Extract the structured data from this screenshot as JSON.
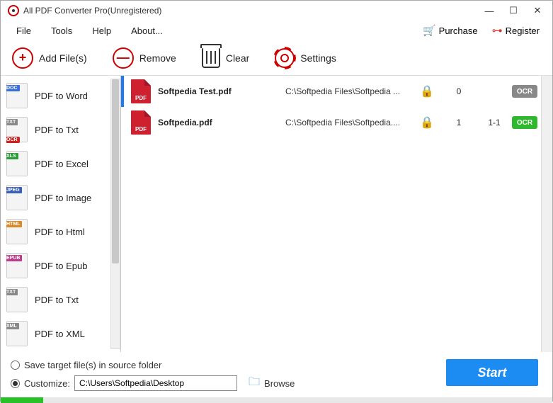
{
  "title": "All PDF Converter Pro(Unregistered)",
  "menu": {
    "file": "File",
    "tools": "Tools",
    "help": "Help",
    "about": "About...",
    "purchase": "Purchase",
    "register": "Register"
  },
  "toolbar": {
    "add": "Add File(s)",
    "remove": "Remove",
    "clear": "Clear",
    "settings": "Settings"
  },
  "sidebar": [
    {
      "label": "PDF to Word",
      "tag": "DOC",
      "tagClass": "tag-doc"
    },
    {
      "label": "PDF to Txt",
      "tag": "TXT",
      "tagClass": "tag-txt",
      "ocr": true
    },
    {
      "label": "PDF to Excel",
      "tag": "XLS",
      "tagClass": "tag-xls"
    },
    {
      "label": "PDF to Image",
      "tag": "JPEG",
      "tagClass": "tag-jpg"
    },
    {
      "label": "PDF to Html",
      "tag": "HTML",
      "tagClass": "tag-html"
    },
    {
      "label": "PDF to Epub",
      "tag": "EPUB",
      "tagClass": "tag-epub"
    },
    {
      "label": "PDF to Txt",
      "tag": "TXT",
      "tagClass": "tag-txt"
    },
    {
      "label": "PDF to XML",
      "tag": "XML",
      "tagClass": "tag-xml"
    }
  ],
  "files": [
    {
      "name": "Softpedia Test.pdf",
      "path": "C:\\Softpedia Files\\Softpedia ...",
      "locked": true,
      "col1": "0",
      "col2": "",
      "ocr": "gray",
      "selected": true
    },
    {
      "name": "Softpedia.pdf",
      "path": "C:\\Softpedia Files\\Softpedia....",
      "locked": true,
      "col1": "1",
      "col2": "1-1",
      "ocr": "green",
      "selected": false
    }
  ],
  "bottom": {
    "saveInSource": "Save target file(s) in source folder",
    "customize": "Customize:",
    "path": "C:\\Users\\Softpedia\\Desktop",
    "browse": "Browse",
    "start": "Start"
  },
  "ocrLabel": "OCR",
  "pdfLabel": "PDF"
}
